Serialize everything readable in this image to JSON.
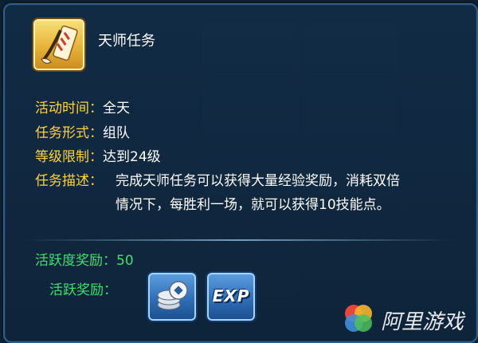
{
  "task": {
    "icon": "scroll-and-brush-icon",
    "title": "天师任务"
  },
  "details": [
    {
      "label": "活动时间：",
      "value": "全天"
    },
    {
      "label": "任务形式：",
      "value": "组队"
    },
    {
      "label": "等级限制：",
      "value": "达到24级"
    }
  ],
  "description": {
    "label": "任务描述：",
    "lines": [
      "完成天师任务可以获得大量经验奖励，消耗双倍",
      "情况下，每胜利一场，就可以获得10技能点。"
    ]
  },
  "activity": {
    "label": "活跃度奖励：",
    "value": "50"
  },
  "rewards": {
    "label": "活跃奖励：",
    "items": [
      {
        "icon": "silver-coins-icon"
      },
      {
        "icon": "exp-icon",
        "text": "EXP"
      }
    ]
  },
  "watermark": {
    "text": "阿里游戏",
    "icon": "aliyun-game-logo-icon"
  },
  "colors": {
    "label_yellow": "#ffd43a",
    "label_green": "#3fe06a",
    "text_white": "#ffffff",
    "panel_bg": "#122c46"
  }
}
